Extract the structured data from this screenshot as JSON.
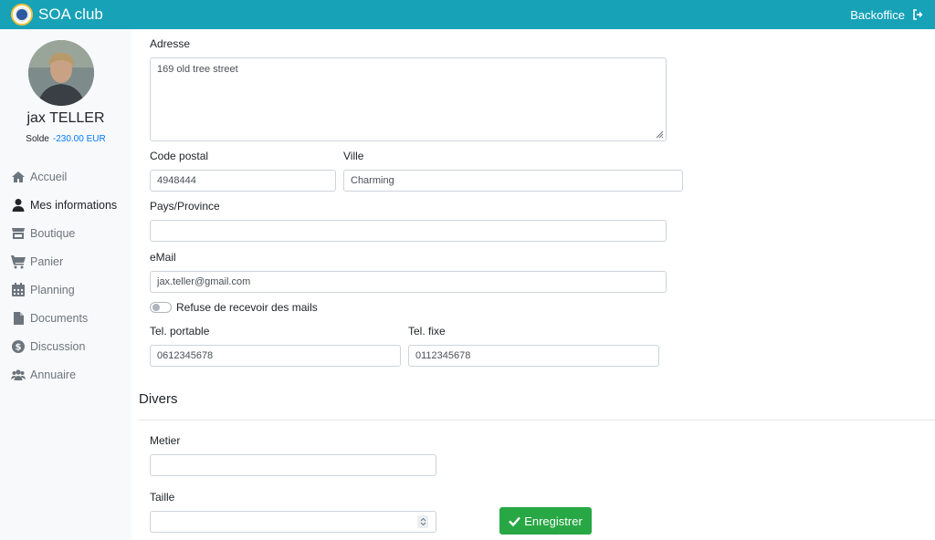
{
  "header": {
    "app_name": "SOA club",
    "backoffice_label": "Backoffice"
  },
  "sidebar": {
    "user_name": "jax TELLER",
    "balance_label": "Solde",
    "balance_value": "-230.00 EUR",
    "items": [
      {
        "label": "Accueil",
        "icon": "home-icon"
      },
      {
        "label": "Mes informations",
        "icon": "user-icon",
        "active": true
      },
      {
        "label": "Boutique",
        "icon": "store-icon"
      },
      {
        "label": "Panier",
        "icon": "cart-icon"
      },
      {
        "label": "Planning",
        "icon": "calendar-icon"
      },
      {
        "label": "Documents",
        "icon": "file-icon"
      },
      {
        "label": "Discussion",
        "icon": "dollar-circle-icon"
      },
      {
        "label": "Annuaire",
        "icon": "users-icon"
      }
    ]
  },
  "form": {
    "address_label": "Adresse",
    "address_value": "169 old tree street",
    "postal_code_label": "Code postal",
    "postal_code_value": "4948444",
    "city_label": "Ville",
    "city_value": "Charming",
    "country_label": "Pays/Province",
    "country_value": "",
    "email_label": "eMail",
    "email_value": "jax.teller@gmail.com",
    "refuse_mail_label": "Refuse de recevoir des mails",
    "refuse_mail_checked": false,
    "mobile_label": "Tel. portable",
    "mobile_value": "0612345678",
    "landline_label": "Tel. fixe",
    "landline_value": "0112345678",
    "misc_title": "Divers",
    "job_label": "Metier",
    "job_value": "",
    "height_label": "Taille",
    "height_value": "",
    "save_label": "Enregistrer"
  },
  "colors": {
    "topbar": "#17a2b8",
    "sidebar_bg": "#f8f9fa",
    "balance": "#007bff",
    "save_button": "#28a745"
  }
}
